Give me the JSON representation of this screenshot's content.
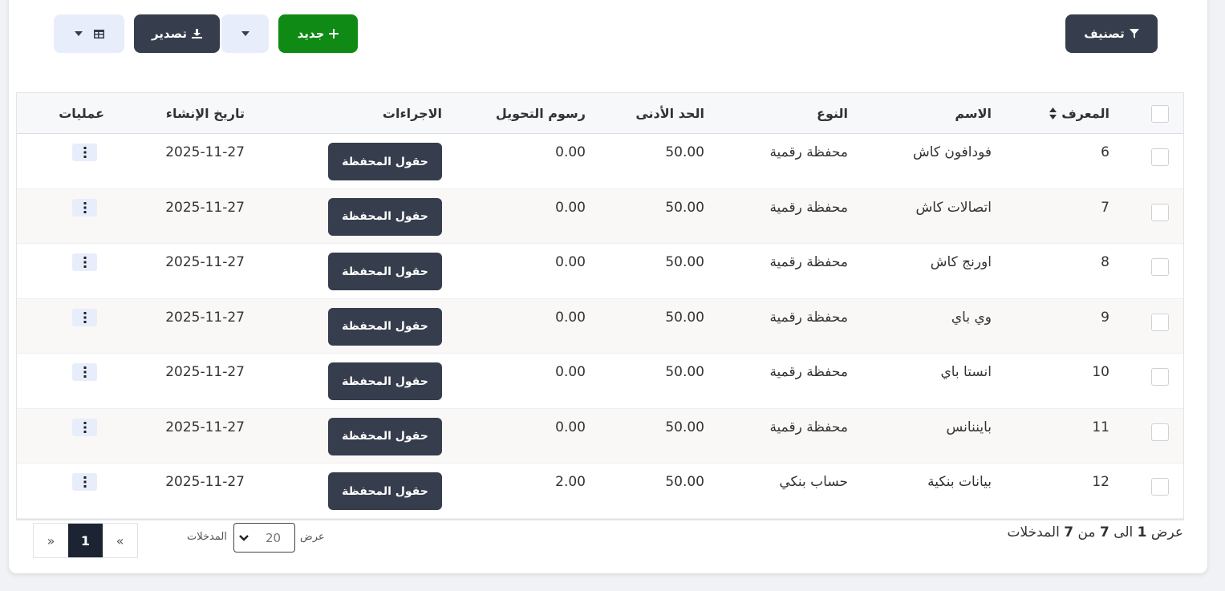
{
  "toolbar": {
    "filter_label": "تصنيف",
    "new_label": "جديد",
    "export_label": "تصدير"
  },
  "table": {
    "headers": {
      "id": "المعرف",
      "name": "الاسم",
      "type": "النوع",
      "min": "الحد الأدنى",
      "fee": "رسوم التحويل",
      "actions": "الاجراءات",
      "created": "تاريخ الإنشاء",
      "ops": "عمليات"
    },
    "wallet_fields_label": "حقول المحفظة",
    "rows": [
      {
        "id": "6",
        "name": "فودافون كاش",
        "type": "محفظة رقمية",
        "min": "50.00",
        "fee": "0.00",
        "created": "2025-11-27"
      },
      {
        "id": "7",
        "name": "اتصالات كاش",
        "type": "محفظة رقمية",
        "min": "50.00",
        "fee": "0.00",
        "created": "2025-11-27"
      },
      {
        "id": "8",
        "name": "اورنج كاش",
        "type": "محفظة رقمية",
        "min": "50.00",
        "fee": "0.00",
        "created": "2025-11-27"
      },
      {
        "id": "9",
        "name": "وي باي",
        "type": "محفظة رقمية",
        "min": "50.00",
        "fee": "0.00",
        "created": "2025-11-27"
      },
      {
        "id": "10",
        "name": "انستا باي",
        "type": "محفظة رقمية",
        "min": "50.00",
        "fee": "0.00",
        "created": "2025-11-27"
      },
      {
        "id": "11",
        "name": "بايننانس",
        "type": "محفظة رقمية",
        "min": "50.00",
        "fee": "0.00",
        "created": "2025-11-27"
      },
      {
        "id": "12",
        "name": "بيانات بنكية",
        "type": "حساب بنكي",
        "min": "50.00",
        "fee": "2.00",
        "created": "2025-11-27"
      }
    ]
  },
  "footer": {
    "info_prefix": "عرض",
    "info_from": "1",
    "info_to_word": "الى",
    "info_to": "7",
    "info_of_word": "من",
    "info_total": "7",
    "info_suffix": "المدخلات",
    "length_show": "عرض",
    "length_value": "20",
    "length_entries": "المدخلات"
  },
  "pagination": {
    "prev": "«",
    "current": "1",
    "next": "»"
  },
  "colors": {
    "dark": "#363e4d",
    "green": "#0f8a14",
    "light": "#e8edfb"
  }
}
